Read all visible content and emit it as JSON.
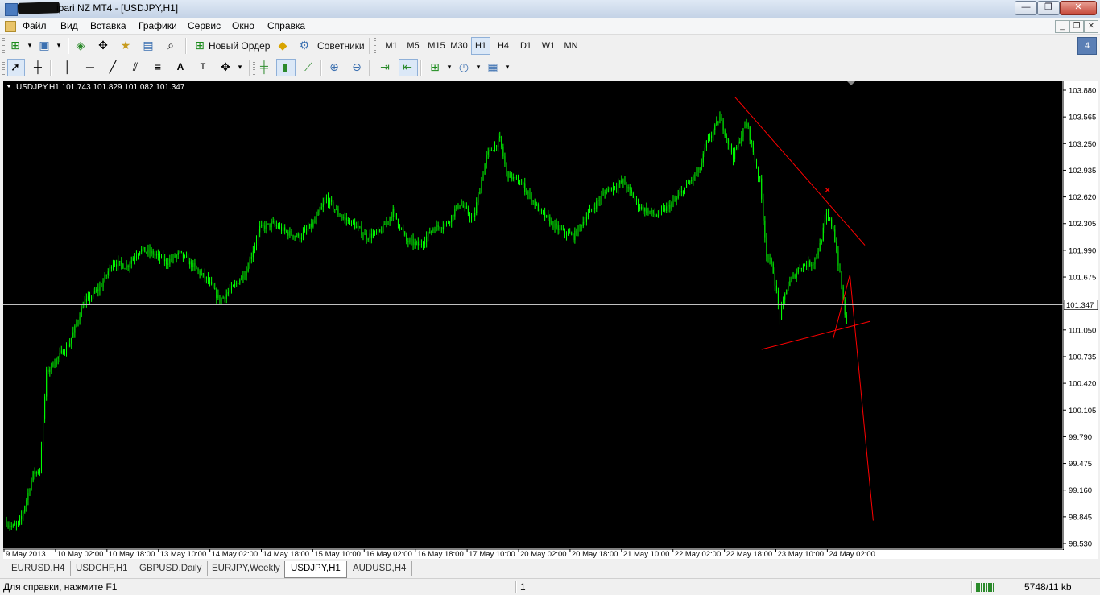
{
  "window": {
    "title": "ipari NZ MT4 - [USDJPY,H1]",
    "controls": [
      "—",
      "❐",
      "✕"
    ]
  },
  "menu": [
    "Файл",
    "Вид",
    "Вставка",
    "Графики",
    "Сервис",
    "Окно",
    "Справка"
  ],
  "toolbar1": {
    "new_order": "Новый Ордер",
    "advisors": "Советники",
    "periods": [
      "M1",
      "M5",
      "M15",
      "M30",
      "H1",
      "H4",
      "D1",
      "W1",
      "MN"
    ],
    "active_period": "H1"
  },
  "chart_data": {
    "type": "candlestick",
    "symbol_info": "USDJPY,H1  101.743 101.829 101.082 101.347",
    "ylim": [
      98.53,
      103.88
    ],
    "yticks": [
      "103.880",
      "103.565",
      "103.250",
      "102.935",
      "102.620",
      "102.305",
      "101.990",
      "101.675",
      "101.360",
      "101.050",
      "100.735",
      "100.420",
      "100.105",
      "99.790",
      "99.475",
      "99.160",
      "98.845",
      "98.530"
    ],
    "current_price": "101.347",
    "xticks": [
      "9 May 2013",
      "10 May 02:00",
      "10 May 18:00",
      "13 May 10:00",
      "14 May 02:00",
      "14 May 18:00",
      "15 May 10:00",
      "16 May 02:00",
      "16 May 18:00",
      "17 May 10:00",
      "20 May 02:00",
      "20 May 18:00",
      "21 May 10:00",
      "22 May 02:00",
      "22 May 18:00",
      "23 May 10:00",
      "24 May 02:00"
    ],
    "bar_count": 262,
    "close_path": [
      [
        0,
        98.78
      ],
      [
        4,
        98.72
      ],
      [
        8,
        98.78
      ],
      [
        12,
        99.05
      ],
      [
        16,
        99.35
      ],
      [
        20,
        99.4
      ],
      [
        24,
        100.55
      ],
      [
        30,
        100.7
      ],
      [
        38,
        100.9
      ],
      [
        46,
        101.35
      ],
      [
        56,
        101.55
      ],
      [
        64,
        101.85
      ],
      [
        72,
        101.8
      ],
      [
        80,
        102.0
      ],
      [
        88,
        101.95
      ],
      [
        96,
        101.85
      ],
      [
        104,
        101.95
      ],
      [
        112,
        101.8
      ],
      [
        120,
        101.65
      ],
      [
        128,
        101.4
      ],
      [
        136,
        101.55
      ],
      [
        144,
        101.75
      ],
      [
        152,
        102.25
      ],
      [
        160,
        102.3
      ],
      [
        168,
        102.2
      ],
      [
        176,
        102.15
      ],
      [
        184,
        102.3
      ],
      [
        192,
        102.6
      ],
      [
        200,
        102.4
      ],
      [
        208,
        102.3
      ],
      [
        216,
        102.15
      ],
      [
        224,
        102.2
      ],
      [
        232,
        102.45
      ],
      [
        240,
        102.1
      ],
      [
        248,
        102.05
      ],
      [
        256,
        102.25
      ],
      [
        264,
        102.3
      ],
      [
        272,
        102.55
      ],
      [
        280,
        102.35
      ],
      [
        288,
        103.1
      ],
      [
        296,
        103.3
      ],
      [
        300,
        102.9
      ],
      [
        310,
        102.75
      ],
      [
        320,
        102.45
      ],
      [
        330,
        102.25
      ],
      [
        340,
        102.15
      ],
      [
        350,
        102.45
      ],
      [
        360,
        102.7
      ],
      [
        370,
        102.8
      ],
      [
        380,
        102.5
      ],
      [
        390,
        102.4
      ],
      [
        400,
        102.55
      ],
      [
        410,
        102.8
      ],
      [
        416,
        102.95
      ],
      [
        420,
        103.25
      ],
      [
        428,
        103.55
      ],
      [
        436,
        103.1
      ],
      [
        444,
        103.5
      ],
      [
        452,
        102.8
      ],
      [
        456,
        101.95
      ],
      [
        460,
        101.75
      ],
      [
        464,
        101.2
      ],
      [
        468,
        101.55
      ],
      [
        476,
        101.8
      ],
      [
        484,
        101.85
      ],
      [
        488,
        102.05
      ],
      [
        492,
        102.4
      ],
      [
        496,
        102.25
      ],
      [
        500,
        101.7
      ],
      [
        504,
        101.1
      ]
    ],
    "drawings": [
      {
        "type": "line",
        "color": "#ff0000",
        "points": [
          [
            437,
            103.8
          ],
          [
            515,
            102.05
          ]
        ]
      },
      {
        "type": "line",
        "color": "#ff0000",
        "points": [
          [
            453,
            100.82
          ],
          [
            518,
            101.15
          ]
        ]
      },
      {
        "type": "polyline",
        "color": "#ff0000",
        "points": [
          [
            496,
            100.95
          ],
          [
            506,
            101.7
          ],
          [
            520,
            98.8
          ]
        ]
      },
      {
        "type": "marker",
        "color": "#ff0000",
        "symbol": "×",
        "point": [
          492,
          102.7
        ]
      }
    ],
    "colors": {
      "background": "#000000",
      "bars": "#00ff00",
      "axis": "#ffffff",
      "drawings": "#ff0000"
    }
  },
  "tabs": [
    "EURUSD,H4",
    "USDCHF,H1",
    "GBPUSD,Daily",
    "EURJPY,Weekly",
    "USDJPY,H1",
    "AUDUSD,H4"
  ],
  "active_tab": "USDJPY,H1",
  "status": {
    "help": "Для справки, нажмите F1",
    "profile": "1",
    "traffic": "5748/11 kb"
  }
}
